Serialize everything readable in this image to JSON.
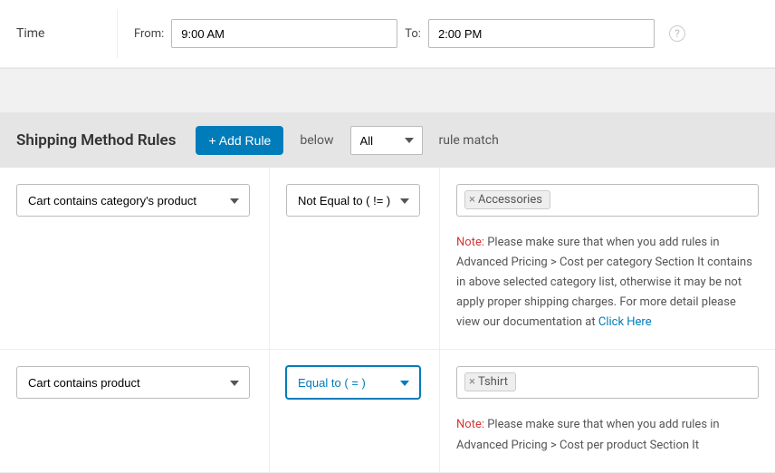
{
  "time": {
    "label": "Time",
    "from_label": "From:",
    "from_value": "9:00 AM",
    "to_label": "To:",
    "to_value": "2:00 PM",
    "help": "?"
  },
  "rules_header": {
    "title": "Shipping Method Rules",
    "add_button": "+ Add Rule",
    "below": "below",
    "match_scope": "All",
    "rule_match": "rule match"
  },
  "rules": [
    {
      "condition": "Cart contains category's product",
      "operator": "Not Equal to ( != )",
      "operator_focused": false,
      "tag": "Accessories",
      "note_label": "Note:",
      "note_text": " Please make sure that when you add rules in Advanced Pricing > Cost per category Section It contains in above selected category list, otherwise it may be not apply proper shipping charges. For more detail please view our documentation at ",
      "link": "Click Here"
    },
    {
      "condition": "Cart contains product",
      "operator": "Equal to ( = )",
      "operator_focused": true,
      "tag": "Tshirt",
      "note_label": "Note:",
      "note_text": " Please make sure that when you add rules in Advanced Pricing > Cost per product Section It ",
      "link": ""
    }
  ]
}
